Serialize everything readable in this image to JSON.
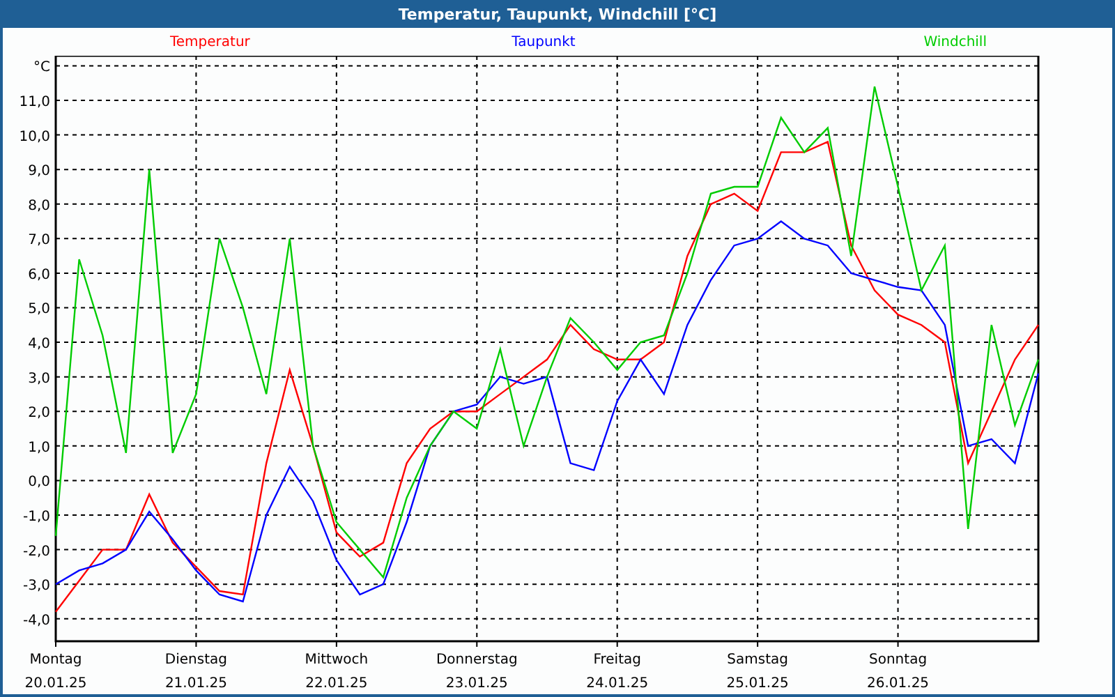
{
  "window": {
    "title": "Temperatur, Taupunkt, Windchill [°C]"
  },
  "chart": {
    "chart_data": {
      "type": "line",
      "grid": true,
      "ylim": [
        -4.65,
        12.29
      ],
      "categories": [
        "20.01.25",
        null,
        null,
        null,
        null,
        null,
        "21.01.25",
        null,
        null,
        null,
        null,
        null,
        "22.01.25",
        null,
        null,
        null,
        null,
        null,
        "23.01.25",
        null,
        null,
        null,
        null,
        null,
        "24.01.25",
        null,
        null,
        null,
        null,
        null,
        "25.01.25",
        null,
        null,
        null,
        null,
        null,
        "26.01.25",
        null,
        null,
        null,
        null,
        null,
        null
      ],
      "series": [
        {
          "name": "Temperatur",
          "color": "#ff0000",
          "values": [
            -3.8,
            -2.9,
            -2.0,
            -2.0,
            -0.4,
            -1.8,
            -2.5,
            -3.2,
            -3.3,
            0.5,
            3.2,
            1.0,
            -1.5,
            -2.2,
            -1.8,
            0.5,
            1.5,
            2.0,
            2.0,
            2.5,
            3.0,
            3.5,
            4.5,
            3.8,
            3.5,
            3.5,
            4.0,
            6.5,
            8.0,
            8.3,
            7.8,
            9.5,
            9.5,
            9.8,
            6.8,
            5.5,
            4.8,
            4.5,
            4.0,
            0.5,
            2.0,
            3.5,
            4.5
          ]
        },
        {
          "name": "Taupunkt",
          "color": "#0000ff",
          "values": [
            -3.0,
            -2.6,
            -2.4,
            -2.0,
            -0.9,
            -1.7,
            -2.6,
            -3.3,
            -3.5,
            -1.0,
            0.4,
            -0.6,
            -2.3,
            -3.3,
            -3.0,
            -1.2,
            1.0,
            2.0,
            2.2,
            3.0,
            2.8,
            3.0,
            0.5,
            0.3,
            2.3,
            3.5,
            2.5,
            4.5,
            5.8,
            6.8,
            7.0,
            7.5,
            7.0,
            6.8,
            6.0,
            5.8,
            5.6,
            5.5,
            4.5,
            1.0,
            1.2,
            0.5,
            3.1
          ]
        },
        {
          "name": "Windchill",
          "color": "#00cc00",
          "values": [
            -1.6,
            6.4,
            4.2,
            0.8,
            9.0,
            0.8,
            2.5,
            7.0,
            5.0,
            2.5,
            7.0,
            1.0,
            -1.2,
            -2.0,
            -2.8,
            -0.5,
            1.0,
            2.0,
            1.5,
            3.8,
            1.0,
            3.0,
            4.7,
            4.0,
            3.2,
            4.0,
            4.2,
            6.0,
            8.3,
            8.5,
            8.5,
            10.5,
            9.5,
            10.2,
            6.5,
            11.4,
            8.5,
            5.5,
            6.8,
            -1.4,
            4.5,
            1.6,
            3.5
          ]
        }
      ],
      "yticks": [
        {
          "value": -4,
          "label": "-4,0"
        },
        {
          "value": -3,
          "label": "-3,0"
        },
        {
          "value": -2,
          "label": "-2,0"
        },
        {
          "value": -1,
          "label": "-1,0"
        },
        {
          "value": 0,
          "label": "0,0"
        },
        {
          "value": 1,
          "label": "1,0"
        },
        {
          "value": 2,
          "label": "2,0"
        },
        {
          "value": 3,
          "label": "3,0"
        },
        {
          "value": 4,
          "label": "4,0"
        },
        {
          "value": 5,
          "label": "5,0"
        },
        {
          "value": 6,
          "label": "6,0"
        },
        {
          "value": 7,
          "label": "7,0"
        },
        {
          "value": 8,
          "label": "8,0"
        },
        {
          "value": 9,
          "label": "9,0"
        },
        {
          "value": 10,
          "label": "10,0"
        },
        {
          "value": 11,
          "label": "11,0"
        },
        {
          "value": 12,
          "label": "°C"
        }
      ]
    },
    "x_day_labels": [
      "Montag",
      "Dienstag",
      "Mittwoch",
      "Donnerstag",
      "Freitag",
      "Samstag",
      "Sonntag"
    ]
  }
}
